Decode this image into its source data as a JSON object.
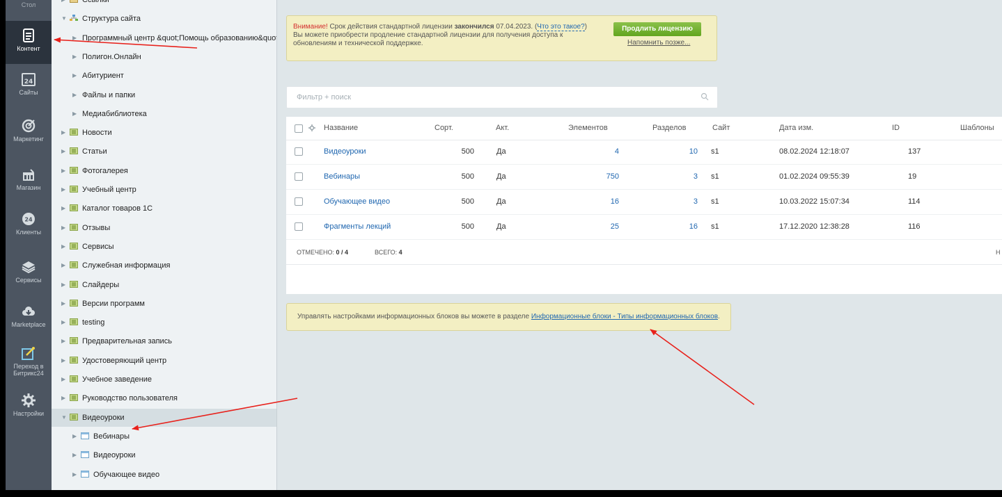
{
  "left_menu": {
    "top_cut_label": "Стол",
    "items": [
      {
        "label": "Контент",
        "icon": "content-icon",
        "active": true
      },
      {
        "label": "Сайты",
        "icon": "calendar-24-icon"
      },
      {
        "label": "Маркетинг",
        "icon": "target-icon"
      },
      {
        "label": "Магазин",
        "icon": "shop-icon"
      },
      {
        "label": "Клиенты",
        "icon": "clients-icon"
      },
      {
        "label": "Сервисы",
        "icon": "layers-icon"
      },
      {
        "label": "Marketplace",
        "icon": "cloud-download-icon"
      },
      {
        "label": "Переход в Битрикс24",
        "icon": "external-edit-icon"
      },
      {
        "label": "Настройки",
        "icon": "gear-icon"
      }
    ]
  },
  "tree": {
    "items": [
      {
        "label": "Ссылки",
        "icon": "folder"
      },
      {
        "label": "Структура сайта",
        "icon": "sitemap"
      },
      {
        "label": "Программный центр &quot;Помощь образованию&quot;",
        "icon": "none"
      },
      {
        "label": "Полигон.Онлайн",
        "icon": "none"
      },
      {
        "label": "Абитуриент",
        "icon": "none"
      },
      {
        "label": "Файлы и папки",
        "icon": "none"
      },
      {
        "label": "Медиабиблиотека",
        "icon": "none"
      },
      {
        "label": "Новости",
        "icon": "iblock"
      },
      {
        "label": "Статьи",
        "icon": "iblock"
      },
      {
        "label": "Фотогалерея",
        "icon": "iblock"
      },
      {
        "label": "Учебный центр",
        "icon": "iblock"
      },
      {
        "label": "Каталог товаров 1С",
        "icon": "iblock"
      },
      {
        "label": "Отзывы",
        "icon": "iblock"
      },
      {
        "label": "Сервисы",
        "icon": "iblock"
      },
      {
        "label": "Служебная информация",
        "icon": "iblock"
      },
      {
        "label": "Слайдеры",
        "icon": "iblock"
      },
      {
        "label": "Версии программ",
        "icon": "iblock"
      },
      {
        "label": "testing",
        "icon": "iblock"
      },
      {
        "label": "Предварительная запись",
        "icon": "iblock"
      },
      {
        "label": "Удостоверяющий центр",
        "icon": "iblock"
      },
      {
        "label": "Учебное заведение",
        "icon": "iblock"
      },
      {
        "label": "Руководство пользователя",
        "icon": "iblock"
      },
      {
        "label": "Видеоуроки",
        "icon": "iblock",
        "selected": true,
        "expanded": true
      },
      {
        "label": "Вебинары",
        "icon": "list"
      },
      {
        "label": "Видеоуроки",
        "icon": "list"
      },
      {
        "label": "Обучающее видео",
        "icon": "list"
      }
    ]
  },
  "license": {
    "warning": "Внимание!",
    "text1": " Срок действия стандартной лицензии ",
    "bold": "закончился",
    "date": " 07.04.2023. (",
    "what_link": "Что это такое?",
    "close_paren": ")",
    "text2": "Вы можете приобрести продление стандартной лицензии для получения доступа к обновлениям и технической поддержке.",
    "renew_button": "Продлить лицензию",
    "remind_link": "Напомнить позже..."
  },
  "filter": {
    "placeholder": "Фильтр + поиск"
  },
  "grid": {
    "columns": {
      "name": "Название",
      "sort": "Сорт.",
      "active": "Акт.",
      "elements": "Элементов",
      "sections": "Разделов",
      "site": "Сайт",
      "date": "Дата изм.",
      "id": "ID",
      "templates": "Шаблоны"
    },
    "rows": [
      {
        "name": "Видеоуроки",
        "sort": "500",
        "active": "Да",
        "elements": "4",
        "sections": "10",
        "site": "s1",
        "date": "08.02.2024 12:18:07",
        "id": "137"
      },
      {
        "name": "Вебинары",
        "sort": "500",
        "active": "Да",
        "elements": "750",
        "sections": "3",
        "site": "s1",
        "date": "01.02.2024 09:55:39",
        "id": "19"
      },
      {
        "name": "Обучающее видео",
        "sort": "500",
        "active": "Да",
        "elements": "16",
        "sections": "3",
        "site": "s1",
        "date": "10.03.2022 15:07:34",
        "id": "114"
      },
      {
        "name": "Фрагменты лекций",
        "sort": "500",
        "active": "Да",
        "elements": "25",
        "sections": "16",
        "site": "s1",
        "date": "17.12.2020 12:38:28",
        "id": "116"
      }
    ],
    "footer": {
      "checked_label": "ОТМЕЧЕНО:",
      "checked_value": "0 / 4",
      "total_label": "ВСЕГО:",
      "total_value": "4",
      "cut_right": "Н"
    }
  },
  "info": {
    "text": "Управлять настройками информационных блоков вы можете в разделе ",
    "link": "Информационные блоки - Типы информационных блоков",
    "dot": "."
  },
  "colors": {
    "annotation_arrow": "#e8211b",
    "link": "#2067b0",
    "renew_button": "#6aab26"
  }
}
